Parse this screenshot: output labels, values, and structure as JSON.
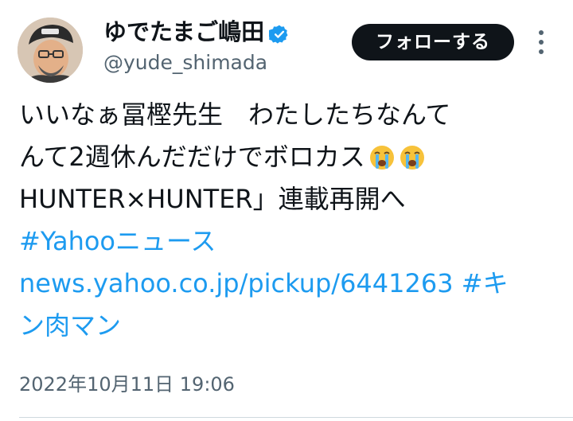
{
  "author": {
    "name": "ゆでたまご嶋田",
    "handle": "@yude_shimada",
    "verified_icon": "verified-badge-icon",
    "accent_color": "#1d9bf0"
  },
  "follow_button": {
    "label": "フォローする"
  },
  "menu": {
    "icon": "more-vertical-icon"
  },
  "tweet": {
    "line1": "いいなぁ冨樫先生　わたしたちなんて",
    "line2": "んて2週休んだだけでボロカス",
    "emoji_icon": "loudly-crying-face-icon",
    "line3": "HUNTER×HUNTER」連載再開へ",
    "hashtag_yahoo": "#Yahooニュース",
    "link_url": "news.yahoo.co.jp/pickup/6441263",
    "hashtag_kin_part1": "#キ",
    "hashtag_kin_part2": "ン肉マン",
    "timestamp": "2022年10月11日 19:06"
  },
  "colors": {
    "text": "#0f1419",
    "secondary": "#536471",
    "link": "#1d9bf0",
    "button_bg": "#0f1419"
  }
}
